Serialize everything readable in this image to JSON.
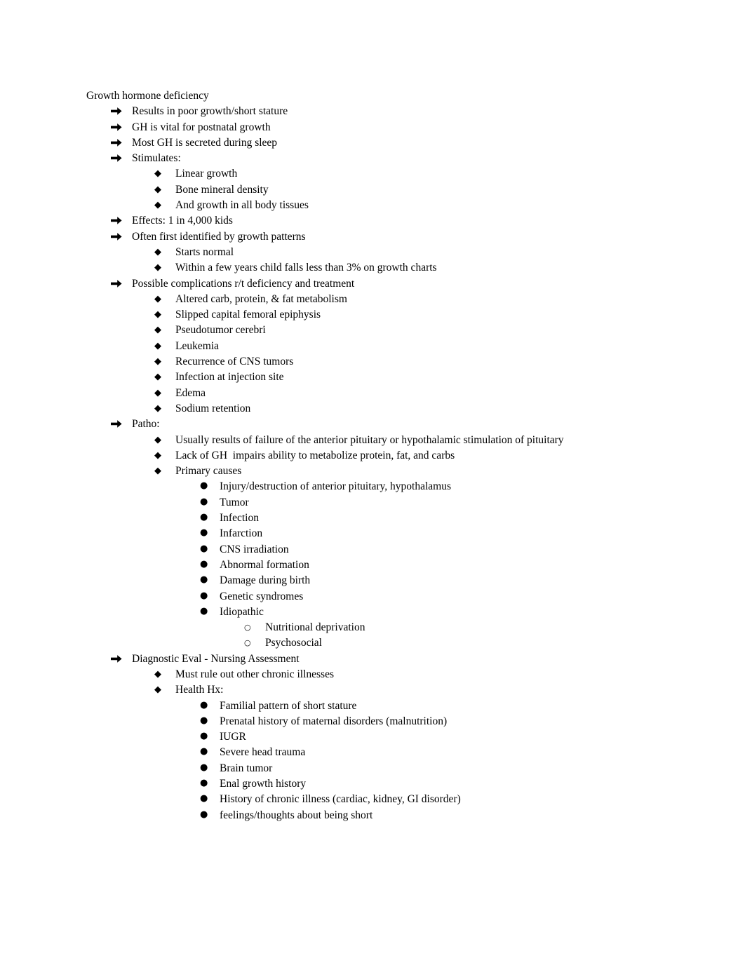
{
  "document": {
    "title": "Growth hormone deficiency",
    "markers": {
      "level1": "arrow-bullet",
      "level2": "diamond-bullet",
      "level3": "round-bullet",
      "level4": "hollow-circle-bullet"
    },
    "outline": [
      {
        "text": "Results in poor growth/short stature"
      },
      {
        "text": "GH is vital for postnatal growth"
      },
      {
        "text": "Most GH is secreted during sleep"
      },
      {
        "text": "Stimulates:",
        "children": [
          {
            "text": "Linear growth"
          },
          {
            "text": "Bone mineral density"
          },
          {
            "text": "And growth in all body tissues"
          }
        ]
      },
      {
        "text": "Effects: 1 in 4,000 kids"
      },
      {
        "text": "Often first identified by growth patterns",
        "children": [
          {
            "text": "Starts normal"
          },
          {
            "text": "Within a few years child falls less than 3% on growth charts"
          }
        ]
      },
      {
        "text": "Possible complications r/t deficiency and treatment",
        "children": [
          {
            "text": "Altered carb, protein, & fat metabolism"
          },
          {
            "text": "Slipped capital femoral epiphysis"
          },
          {
            "text": "Pseudotumor cerebri"
          },
          {
            "text": "Leukemia"
          },
          {
            "text": "Recurrence of CNS tumors"
          },
          {
            "text": "Infection at injection site"
          },
          {
            "text": "Edema"
          },
          {
            "text": "Sodium retention"
          }
        ]
      },
      {
        "text": "Patho:",
        "spaced": true,
        "children": [
          {
            "text": "Usually results of failure of the anterior pituitary or hypothalamic stimulation of pituitary"
          },
          {
            "text": "Lack of GH  impairs ability to metabolize protein, fat, and carbs"
          },
          {
            "text": "Primary causes",
            "children": [
              {
                "text": "Injury/destruction of anterior pituitary, hypothalamus"
              },
              {
                "text": "Tumor"
              },
              {
                "text": "Infection"
              },
              {
                "text": "Infarction"
              },
              {
                "text": "CNS irradiation"
              },
              {
                "text": "Abnormal formation"
              },
              {
                "text": "Damage during birth"
              },
              {
                "text": "Genetic syndromes"
              },
              {
                "text": "Idiopathic",
                "children": [
                  {
                    "text": "Nutritional deprivation"
                  },
                  {
                    "text": "Psychosocial"
                  }
                ]
              }
            ]
          }
        ]
      },
      {
        "text": "Diagnostic Eval - Nursing Assessment",
        "children": [
          {
            "text": "Must rule out other chronic illnesses"
          },
          {
            "text": "Health Hx:",
            "children": [
              {
                "text": "Familial pattern of short stature"
              },
              {
                "text": "Prenatal history of maternal disorders (malnutrition)"
              },
              {
                "text": "IUGR"
              },
              {
                "text": "Severe head trauma"
              },
              {
                "text": "Brain tumor"
              },
              {
                "text": "Enal growth history"
              },
              {
                "text": "History of chronic illness (cardiac, kidney, GI disorder)"
              },
              {
                "text": "feelings/thoughts about being short"
              }
            ]
          }
        ]
      }
    ]
  }
}
